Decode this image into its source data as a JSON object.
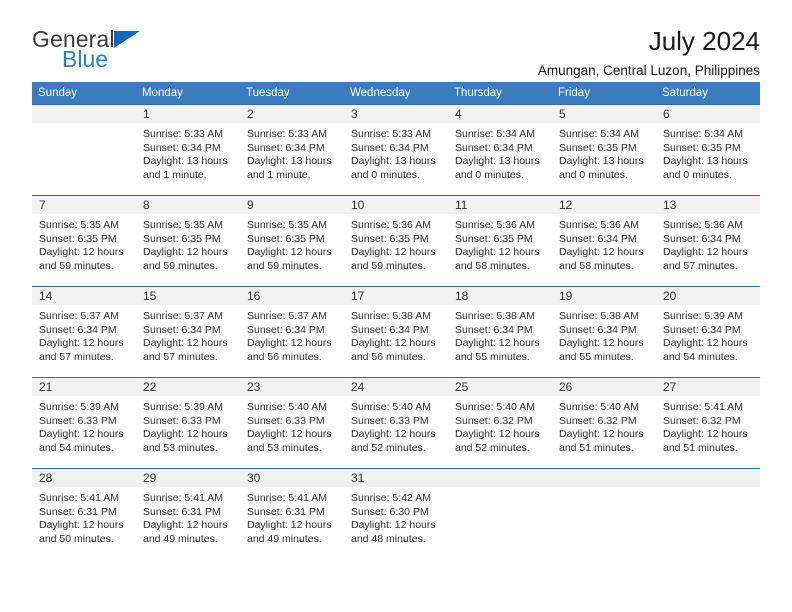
{
  "brand": {
    "word1": "General",
    "word2": "Blue",
    "flag_color": "#1668b3",
    "blue_text_color": "#2583c6"
  },
  "header": {
    "title": "July 2024",
    "location": "Amungan, Central Luzon, Philippines"
  },
  "theme": {
    "header_row_bg": "#3a7cbe",
    "header_row_text": "#ffffff",
    "daynum_bg": "#f1f1f1",
    "row_border": "#2b6ca8"
  },
  "calendar": {
    "weekday_headers": [
      "Sunday",
      "Monday",
      "Tuesday",
      "Wednesday",
      "Thursday",
      "Friday",
      "Saturday"
    ],
    "weeks": [
      [
        {
          "day": "",
          "lines": []
        },
        {
          "day": "1",
          "lines": [
            "Sunrise: 5:33 AM",
            "Sunset: 6:34 PM",
            "Daylight: 13 hours",
            "and 1 minute."
          ]
        },
        {
          "day": "2",
          "lines": [
            "Sunrise: 5:33 AM",
            "Sunset: 6:34 PM",
            "Daylight: 13 hours",
            "and 1 minute."
          ]
        },
        {
          "day": "3",
          "lines": [
            "Sunrise: 5:33 AM",
            "Sunset: 6:34 PM",
            "Daylight: 13 hours",
            "and 0 minutes."
          ]
        },
        {
          "day": "4",
          "lines": [
            "Sunrise: 5:34 AM",
            "Sunset: 6:34 PM",
            "Daylight: 13 hours",
            "and 0 minutes."
          ]
        },
        {
          "day": "5",
          "lines": [
            "Sunrise: 5:34 AM",
            "Sunset: 6:35 PM",
            "Daylight: 13 hours",
            "and 0 minutes."
          ]
        },
        {
          "day": "6",
          "lines": [
            "Sunrise: 5:34 AM",
            "Sunset: 6:35 PM",
            "Daylight: 13 hours",
            "and 0 minutes."
          ]
        }
      ],
      [
        {
          "day": "7",
          "lines": [
            "Sunrise: 5:35 AM",
            "Sunset: 6:35 PM",
            "Daylight: 12 hours",
            "and 59 minutes."
          ]
        },
        {
          "day": "8",
          "lines": [
            "Sunrise: 5:35 AM",
            "Sunset: 6:35 PM",
            "Daylight: 12 hours",
            "and 59 minutes."
          ]
        },
        {
          "day": "9",
          "lines": [
            "Sunrise: 5:35 AM",
            "Sunset: 6:35 PM",
            "Daylight: 12 hours",
            "and 59 minutes."
          ]
        },
        {
          "day": "10",
          "lines": [
            "Sunrise: 5:36 AM",
            "Sunset: 6:35 PM",
            "Daylight: 12 hours",
            "and 59 minutes."
          ]
        },
        {
          "day": "11",
          "lines": [
            "Sunrise: 5:36 AM",
            "Sunset: 6:35 PM",
            "Daylight: 12 hours",
            "and 58 minutes."
          ]
        },
        {
          "day": "12",
          "lines": [
            "Sunrise: 5:36 AM",
            "Sunset: 6:34 PM",
            "Daylight: 12 hours",
            "and 58 minutes."
          ]
        },
        {
          "day": "13",
          "lines": [
            "Sunrise: 5:36 AM",
            "Sunset: 6:34 PM",
            "Daylight: 12 hours",
            "and 57 minutes."
          ]
        }
      ],
      [
        {
          "day": "14",
          "lines": [
            "Sunrise: 5:37 AM",
            "Sunset: 6:34 PM",
            "Daylight: 12 hours",
            "and 57 minutes."
          ]
        },
        {
          "day": "15",
          "lines": [
            "Sunrise: 5:37 AM",
            "Sunset: 6:34 PM",
            "Daylight: 12 hours",
            "and 57 minutes."
          ]
        },
        {
          "day": "16",
          "lines": [
            "Sunrise: 5:37 AM",
            "Sunset: 6:34 PM",
            "Daylight: 12 hours",
            "and 56 minutes."
          ]
        },
        {
          "day": "17",
          "lines": [
            "Sunrise: 5:38 AM",
            "Sunset: 6:34 PM",
            "Daylight: 12 hours",
            "and 56 minutes."
          ]
        },
        {
          "day": "18",
          "lines": [
            "Sunrise: 5:38 AM",
            "Sunset: 6:34 PM",
            "Daylight: 12 hours",
            "and 55 minutes."
          ]
        },
        {
          "day": "19",
          "lines": [
            "Sunrise: 5:38 AM",
            "Sunset: 6:34 PM",
            "Daylight: 12 hours",
            "and 55 minutes."
          ]
        },
        {
          "day": "20",
          "lines": [
            "Sunrise: 5:39 AM",
            "Sunset: 6:34 PM",
            "Daylight: 12 hours",
            "and 54 minutes."
          ]
        }
      ],
      [
        {
          "day": "21",
          "lines": [
            "Sunrise: 5:39 AM",
            "Sunset: 6:33 PM",
            "Daylight: 12 hours",
            "and 54 minutes."
          ]
        },
        {
          "day": "22",
          "lines": [
            "Sunrise: 5:39 AM",
            "Sunset: 6:33 PM",
            "Daylight: 12 hours",
            "and 53 minutes."
          ]
        },
        {
          "day": "23",
          "lines": [
            "Sunrise: 5:40 AM",
            "Sunset: 6:33 PM",
            "Daylight: 12 hours",
            "and 53 minutes."
          ]
        },
        {
          "day": "24",
          "lines": [
            "Sunrise: 5:40 AM",
            "Sunset: 6:33 PM",
            "Daylight: 12 hours",
            "and 52 minutes."
          ]
        },
        {
          "day": "25",
          "lines": [
            "Sunrise: 5:40 AM",
            "Sunset: 6:32 PM",
            "Daylight: 12 hours",
            "and 52 minutes."
          ]
        },
        {
          "day": "26",
          "lines": [
            "Sunrise: 5:40 AM",
            "Sunset: 6:32 PM",
            "Daylight: 12 hours",
            "and 51 minutes."
          ]
        },
        {
          "day": "27",
          "lines": [
            "Sunrise: 5:41 AM",
            "Sunset: 6:32 PM",
            "Daylight: 12 hours",
            "and 51 minutes."
          ]
        }
      ],
      [
        {
          "day": "28",
          "lines": [
            "Sunrise: 5:41 AM",
            "Sunset: 6:31 PM",
            "Daylight: 12 hours",
            "and 50 minutes."
          ]
        },
        {
          "day": "29",
          "lines": [
            "Sunrise: 5:41 AM",
            "Sunset: 6:31 PM",
            "Daylight: 12 hours",
            "and 49 minutes."
          ]
        },
        {
          "day": "30",
          "lines": [
            "Sunrise: 5:41 AM",
            "Sunset: 6:31 PM",
            "Daylight: 12 hours",
            "and 49 minutes."
          ]
        },
        {
          "day": "31",
          "lines": [
            "Sunrise: 5:42 AM",
            "Sunset: 6:30 PM",
            "Daylight: 12 hours",
            "and 48 minutes."
          ]
        },
        {
          "day": "",
          "lines": []
        },
        {
          "day": "",
          "lines": []
        },
        {
          "day": "",
          "lines": []
        }
      ]
    ]
  }
}
